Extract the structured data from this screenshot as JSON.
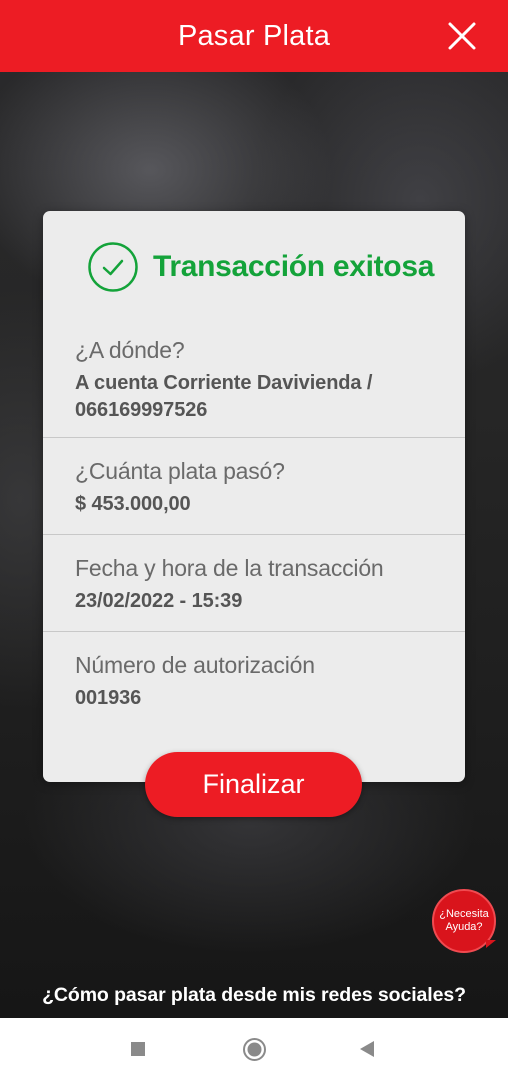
{
  "header": {
    "title": "Pasar Plata",
    "close_icon": "close-icon"
  },
  "card": {
    "status": "Transacción exitosa",
    "status_color": "#14a33a",
    "status_icon": "check-circle-icon",
    "sections": [
      {
        "label": "¿A dónde?",
        "value_line1": "A cuenta Corriente Davivienda /",
        "value_line2": "066169997526"
      },
      {
        "label": "¿Cuánta plata pasó?",
        "value": "$ 453.000,00"
      },
      {
        "label": "Fecha y hora de la transacción",
        "value": "23/02/2022 - 15:39"
      },
      {
        "label": "Número de autorización",
        "value": "001936"
      }
    ]
  },
  "finalize_button": "Finalizar",
  "help": {
    "line1": "¿Necesita",
    "line2": "Ayuda?"
  },
  "social_link": "¿Cómo pasar plata desde mis redes sociales?",
  "navbar": {
    "icons": [
      "recent-apps-icon",
      "home-icon",
      "back-icon"
    ]
  },
  "colors": {
    "brand_red": "#ed1c24",
    "success_green": "#14a33a"
  }
}
